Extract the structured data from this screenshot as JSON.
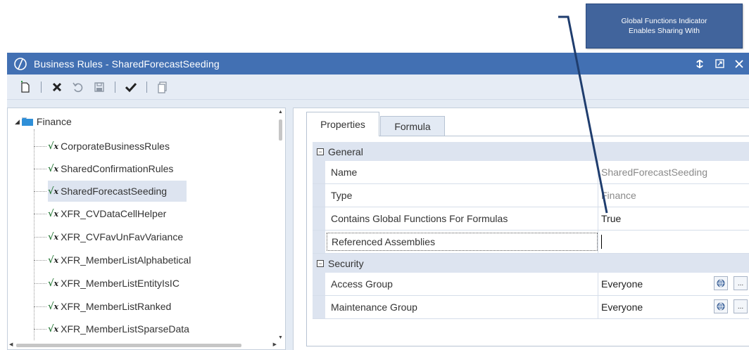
{
  "callout": {
    "line1": "Global Functions Indicator",
    "line2": "Enables Sharing With"
  },
  "window": {
    "title": "Business Rules - SharedForecastSeeding",
    "title_buttons": [
      "sync-icon",
      "restore-icon",
      "close-icon"
    ]
  },
  "toolbar": {
    "icons": [
      "new-icon",
      "delete-icon",
      "revert-icon",
      "save-icon",
      "check-icon",
      "copy-icon"
    ]
  },
  "tree": {
    "root_label": "Finance",
    "items": [
      {
        "label": "CorporateBusinessRules",
        "selected": false
      },
      {
        "label": "SharedConfirmationRules",
        "selected": false
      },
      {
        "label": "SharedForecastSeeding",
        "selected": true
      },
      {
        "label": "XFR_CVDataCellHelper",
        "selected": false
      },
      {
        "label": "XFR_CVFavUnFavVariance",
        "selected": false
      },
      {
        "label": "XFR_MemberListAlphabetical",
        "selected": false
      },
      {
        "label": "XFR_MemberListEntityIsIC",
        "selected": false
      },
      {
        "label": "XFR_MemberListRanked",
        "selected": false
      },
      {
        "label": "XFR_MemberListSparseData",
        "selected": false
      }
    ]
  },
  "tabs": {
    "properties": "Properties",
    "formula": "Formula"
  },
  "properties": {
    "general": {
      "category": "General",
      "name_label": "Name",
      "name_value": "SharedForecastSeeding",
      "type_label": "Type",
      "type_value": "Finance",
      "global_label": "Contains Global Functions For Formulas",
      "global_value": "True",
      "assemblies_label": "Referenced Assemblies",
      "assemblies_value": ""
    },
    "security": {
      "category": "Security",
      "access_label": "Access Group",
      "access_value": "Everyone",
      "maint_label": "Maintenance Group",
      "maint_value": "Everyone",
      "more_label": "..."
    }
  },
  "colors": {
    "titlebar": "#4270b3",
    "callout": "#41649c",
    "selection": "#dde4f0"
  }
}
